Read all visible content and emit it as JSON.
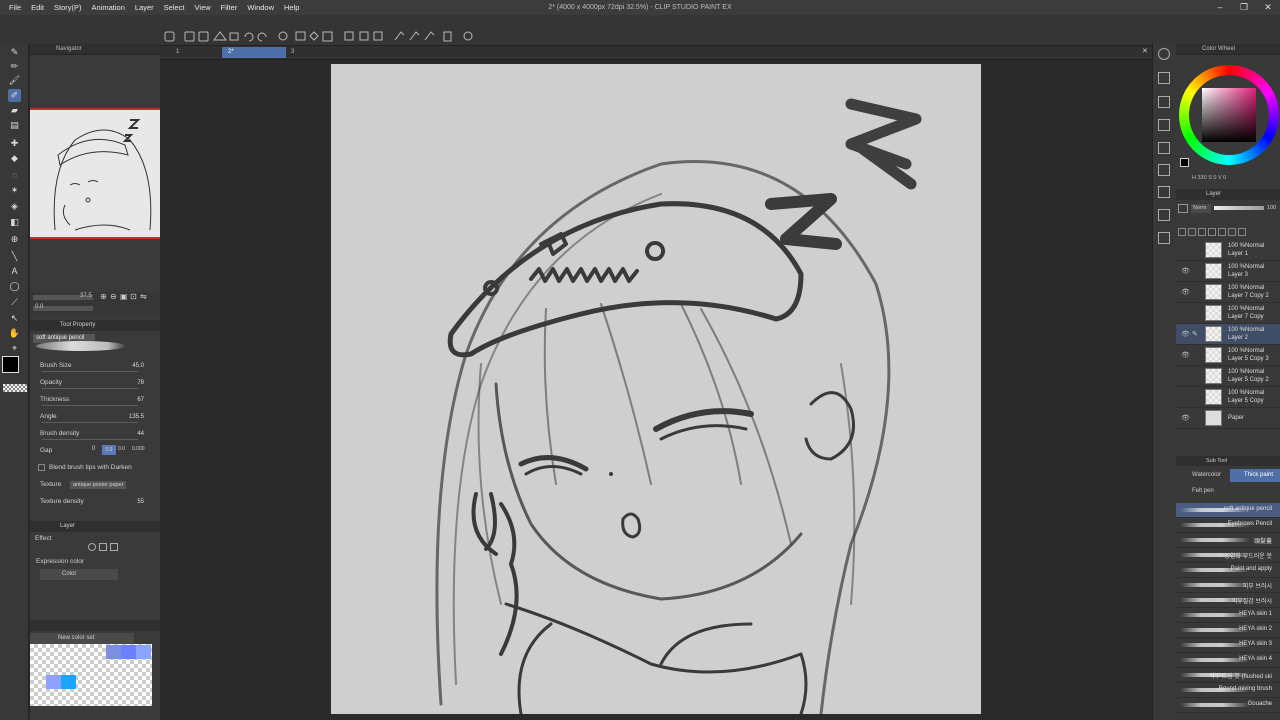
{
  "window": {
    "title": "2* (4000 x 4000px 72dpi 32.5%) - CLIP STUDIO PAINT EX",
    "controls": [
      "–",
      "❐",
      "✕"
    ]
  },
  "menu": [
    "File",
    "Edit",
    "Story(P)",
    "Animation",
    "Layer",
    "Select",
    "View",
    "Filter",
    "Window",
    "Help"
  ],
  "tabs": [
    "1",
    "2*",
    "3"
  ],
  "navigator": {
    "title": "Navigator",
    "zoom": "37.5",
    "rotation": "0.0"
  },
  "tool_property": {
    "title": "Tool Property",
    "brush": "soft antique pencil",
    "rows": [
      {
        "label": "Brush Size",
        "value": "45.0"
      },
      {
        "label": "Opacity",
        "value": "78"
      },
      {
        "label": "Thickness",
        "value": "67"
      },
      {
        "label": "Angle",
        "value": "135.5"
      },
      {
        "label": "Brush density",
        "value": "44"
      },
      {
        "label": "Gap",
        "value": "0"
      }
    ],
    "gap_values": [
      "0.0",
      "0.0",
      "0.000"
    ],
    "blend_label": "Blend brush tips with Darken",
    "texture_label": "Texture",
    "texture_value": "antique poster paper",
    "texture_density_label": "Texture density",
    "texture_density_value": "55"
  },
  "layer_property": {
    "title": "Layer",
    "effect_label": "Effect",
    "expression_label": "Expression color",
    "expression_value": "Color"
  },
  "color_set": {
    "title": "New color set"
  },
  "color_wheel": {
    "title": "Color Wheel",
    "readout": "H 330 S 0 V 0"
  },
  "layer_panel": {
    "title": "Layer",
    "blend_mode": "Norm",
    "opacity": "100",
    "layers": [
      {
        "line1": "100 %Normal",
        "line2": "Layer 1",
        "visible": false,
        "selected": false
      },
      {
        "line1": "100 %Normal",
        "line2": "Layer 3",
        "visible": true,
        "selected": false
      },
      {
        "line1": "100 %Normal",
        "line2": "Layer 7 Copy 2",
        "visible": true,
        "selected": false
      },
      {
        "line1": "100 %Normal",
        "line2": "Layer 7 Copy",
        "visible": false,
        "selected": false
      },
      {
        "line1": "100 %Normal",
        "line2": "Layer 2",
        "visible": true,
        "selected": true
      },
      {
        "line1": "100 %Normal",
        "line2": "Layer 5 Copy 3",
        "visible": true,
        "selected": false
      },
      {
        "line1": "100 %Normal",
        "line2": "Layer 5 Copy 2",
        "visible": false,
        "selected": false
      },
      {
        "line1": "100 %Normal",
        "line2": "Layer 5 Copy",
        "visible": false,
        "selected": false
      },
      {
        "line1": "",
        "line2": "Paper",
        "visible": true,
        "selected": false
      }
    ]
  },
  "sub_tool": {
    "title": "Sub Tool",
    "groups": [
      "Watercolor",
      "Thick paint",
      "Felt pen"
    ],
    "brushes": [
      "soft antique pencil",
      "Eyebrows Pencil",
      "頭髮蓋",
      "동양화 부드러운 붓",
      "Paint and apply",
      "피부 브러시",
      "피부질감 브러시",
      "HEYA skin 1",
      "HEYA skin 2",
      "HEYA skin 3",
      "HEYA skin 4",
      "피부 흐림 붓 (flushed ski",
      "Round mixing brush",
      "Gouache"
    ]
  },
  "colors": {
    "accent": "#4e6fa8",
    "canvas": "#cfcfcf",
    "selection": "#3f4d66",
    "main_color": "#000000",
    "sub_color": "#ffffff"
  }
}
